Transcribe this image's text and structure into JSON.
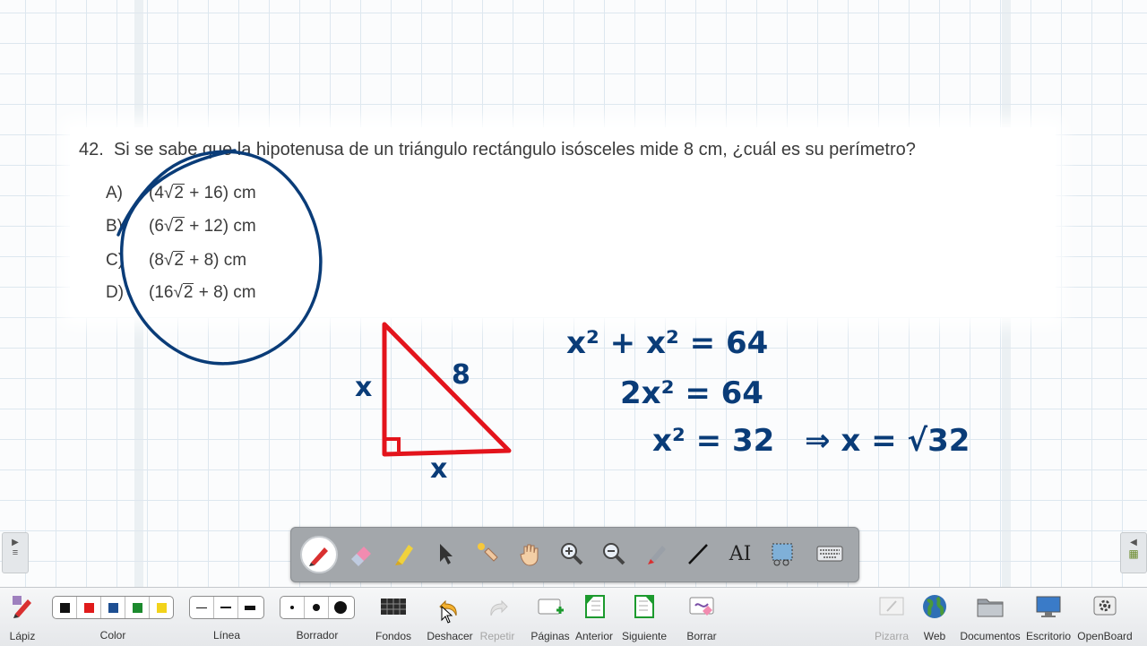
{
  "question": {
    "number": "42.",
    "text": "Si se sabe que la hipotenusa de un triángulo rectángulo isósceles mide 8 cm, ¿cuál es su perímetro?",
    "options": [
      {
        "letter": "A)",
        "pre": "(4",
        "root": "2",
        "post": " + 16) cm"
      },
      {
        "letter": "B)",
        "pre": "(6",
        "root": "2",
        "post": " + 12) cm"
      },
      {
        "letter": "C)",
        "pre": "(8",
        "root": "2",
        "post": " + 8) cm"
      },
      {
        "letter": "D)",
        "pre": "(16",
        "root": "2",
        "post": " + 8) cm"
      }
    ]
  },
  "handwriting": {
    "triangle_leg_left": "x",
    "triangle_leg_bottom": "x",
    "triangle_hypotenuse": "8",
    "eq1": "x² + x² = 64",
    "eq2": "2x² = 64",
    "eq3": "x² = 32",
    "eq4": "⇒ x = √32"
  },
  "colors": {
    "ink_blue": "#0a3c78",
    "ink_red": "#e3141c",
    "text": "#3b3b3b"
  },
  "float_toolbar": {
    "tools": [
      "pen-icon",
      "eraser-icon",
      "highlighter-icon",
      "pointer-icon",
      "laser-hand-icon",
      "hand-icon",
      "zoom-in-icon",
      "zoom-out-icon",
      "marker-icon",
      "line-icon",
      "text-icon",
      "capture-icon",
      "keyboard-icon"
    ],
    "text_tool_glyph": "AI"
  },
  "bottom_bar": {
    "lapiz": "Lápiz",
    "color": "Color",
    "linea": "Línea",
    "borrador": "Borrador",
    "fondos": "Fondos",
    "deshacer": "Deshacer",
    "repetir": "Repetir",
    "paginas": "Páginas",
    "anterior": "Anterior",
    "siguiente": "Siguiente",
    "borrar": "Borrar",
    "pizarra": "Pizarra",
    "web": "Web",
    "documentos": "Documentos",
    "escritorio": "Escritorio",
    "openboard": "OpenBoard",
    "swatches": [
      "#111111",
      "#e01b1b",
      "#1e4f92",
      "#1c8a2e",
      "#f2d31b"
    ]
  }
}
